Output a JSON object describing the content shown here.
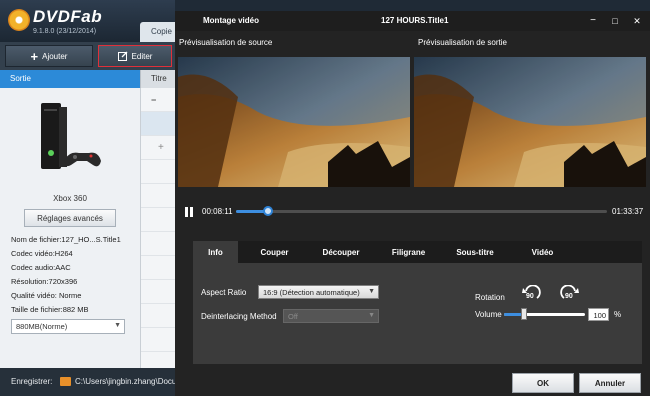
{
  "app": {
    "brand": "DVDFab",
    "version": "9.1.8.0 (23/12/2014)",
    "copy_tab": "Copie",
    "toolbar": {
      "add_label": "Ajouter",
      "edit_label": "Editer"
    },
    "columns": {
      "output": "Sortie",
      "title": "Titre"
    },
    "device": {
      "name": "Xbox 360",
      "advanced_button": "Réglages avancés"
    },
    "file_info": [
      "Nom de fichier:127_HO...S.Title1",
      "Codec vidéo:H264",
      "Codec audio:AAC",
      "Résolution:720x396",
      "Qualité vidéo: Norme",
      "Taille de fichier:882 MB"
    ],
    "size_select": "880MB(Norme)",
    "footer": {
      "register_label": "Enregistrer:",
      "path": "C:\\Users\\jingbin.zhang\\Documents"
    }
  },
  "dialog": {
    "title": "Montage vidéo",
    "file_title": "127  HOURS.Title1",
    "window_buttons": [
      "−",
      "□",
      "✕"
    ],
    "source_preview_label": "Prévisualisation de source",
    "output_preview_label": "Prévisualisation de sortie",
    "player": {
      "current_time": "00:08:11",
      "end_time": "01:33:37",
      "progress": 0.087
    },
    "tabs": [
      "Info",
      "Couper",
      "Découper",
      "Filigrane",
      "Sous-titre",
      "Vidéo"
    ],
    "active_tab": 0,
    "info_panel": {
      "aspect_ratio_label": "Aspect Ratio",
      "aspect_ratio_value": "16:9 (Détection automatique)",
      "deinterlace_label": "Deinterlacing Method",
      "deinterlace_value": "Off",
      "rotation_label": "Rotation",
      "rotate_left_value": "90",
      "rotate_right_value": "90",
      "volume_label": "Volume",
      "volume_value": "100",
      "volume_unit": "%",
      "volume_fraction": 0.25
    },
    "buttons": {
      "ok": "OK",
      "cancel": "Annuler"
    }
  },
  "colors": {
    "accent": "#2c8ad8",
    "edit_highlight": "#e0303a",
    "dialog_bg": "#232323",
    "panel_bg": "#3b3b3b"
  }
}
